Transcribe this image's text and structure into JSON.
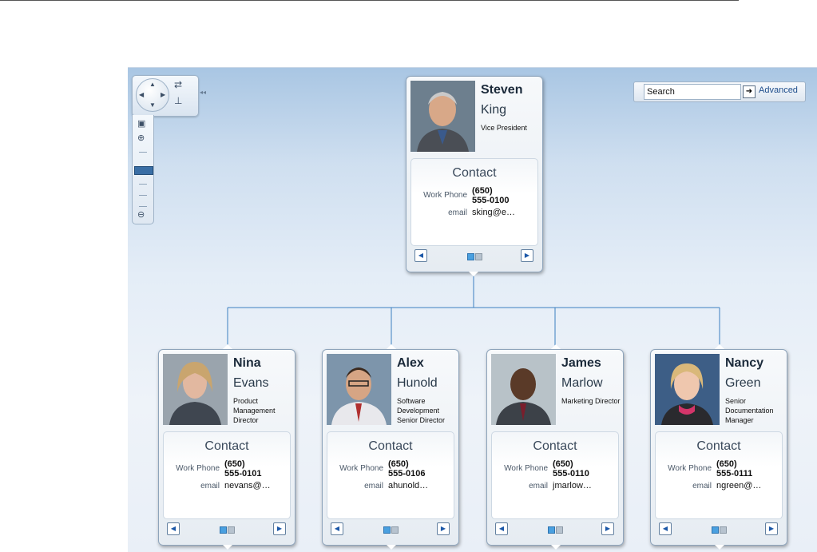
{
  "navigator": {
    "pan_icons": [
      "arrow-up-icon",
      "arrow-down-icon",
      "arrow-left-icon",
      "arrow-right-icon"
    ],
    "layout_icon": "layout-switch-icon",
    "hierarchy_icon": "hierarchy-icon",
    "collapse_icon": "collapse-icon",
    "zoom_fit_icon": "zoom-fit-icon",
    "zoom_in_icon": "zoom-in-icon",
    "zoom_out_icon": "zoom-out-icon"
  },
  "search": {
    "placeholder": "Search",
    "go_icon": "arrow-right-icon",
    "advanced_label": "Advanced"
  },
  "colors": {
    "accent": "#1f4e8c",
    "connector": "#3b7fc0",
    "page_dot_active": "#4aa0e0",
    "page_dot_inactive": "#b7c3cf"
  },
  "root": {
    "first": "Steven",
    "last": "King",
    "title": "Vice President",
    "contact_title": "Contact",
    "phone_label": "Work Phone",
    "phone": "(650)\n555-0100",
    "email_label": "email",
    "email": "sking@e…"
  },
  "children": [
    {
      "first": "Nina",
      "last": "Evans",
      "title": "Product Management Director",
      "contact_title": "Contact",
      "phone_label": "Work Phone",
      "phone": "(650)\n555-0101",
      "email_label": "email",
      "email": "nevans@…"
    },
    {
      "first": "Alex",
      "last": "Hunold",
      "title": "Software Development Senior Director",
      "contact_title": "Contact",
      "phone_label": "Work Phone",
      "phone": "(650)\n555-0106",
      "email_label": "email",
      "email": "ahunold…"
    },
    {
      "first": "James",
      "last": "Marlow",
      "title": "Marketing Director",
      "contact_title": "Contact",
      "phone_label": "Work Phone",
      "phone": "(650)\n555-0110",
      "email_label": "email",
      "email": "jmarlow…"
    },
    {
      "first": "Nancy",
      "last": "Green",
      "title": "Senior Documentation Manager",
      "contact_title": "Contact",
      "phone_label": "Work Phone",
      "phone": "(650)\n555-0111",
      "email_label": "email",
      "email": "ngreen@…"
    }
  ]
}
